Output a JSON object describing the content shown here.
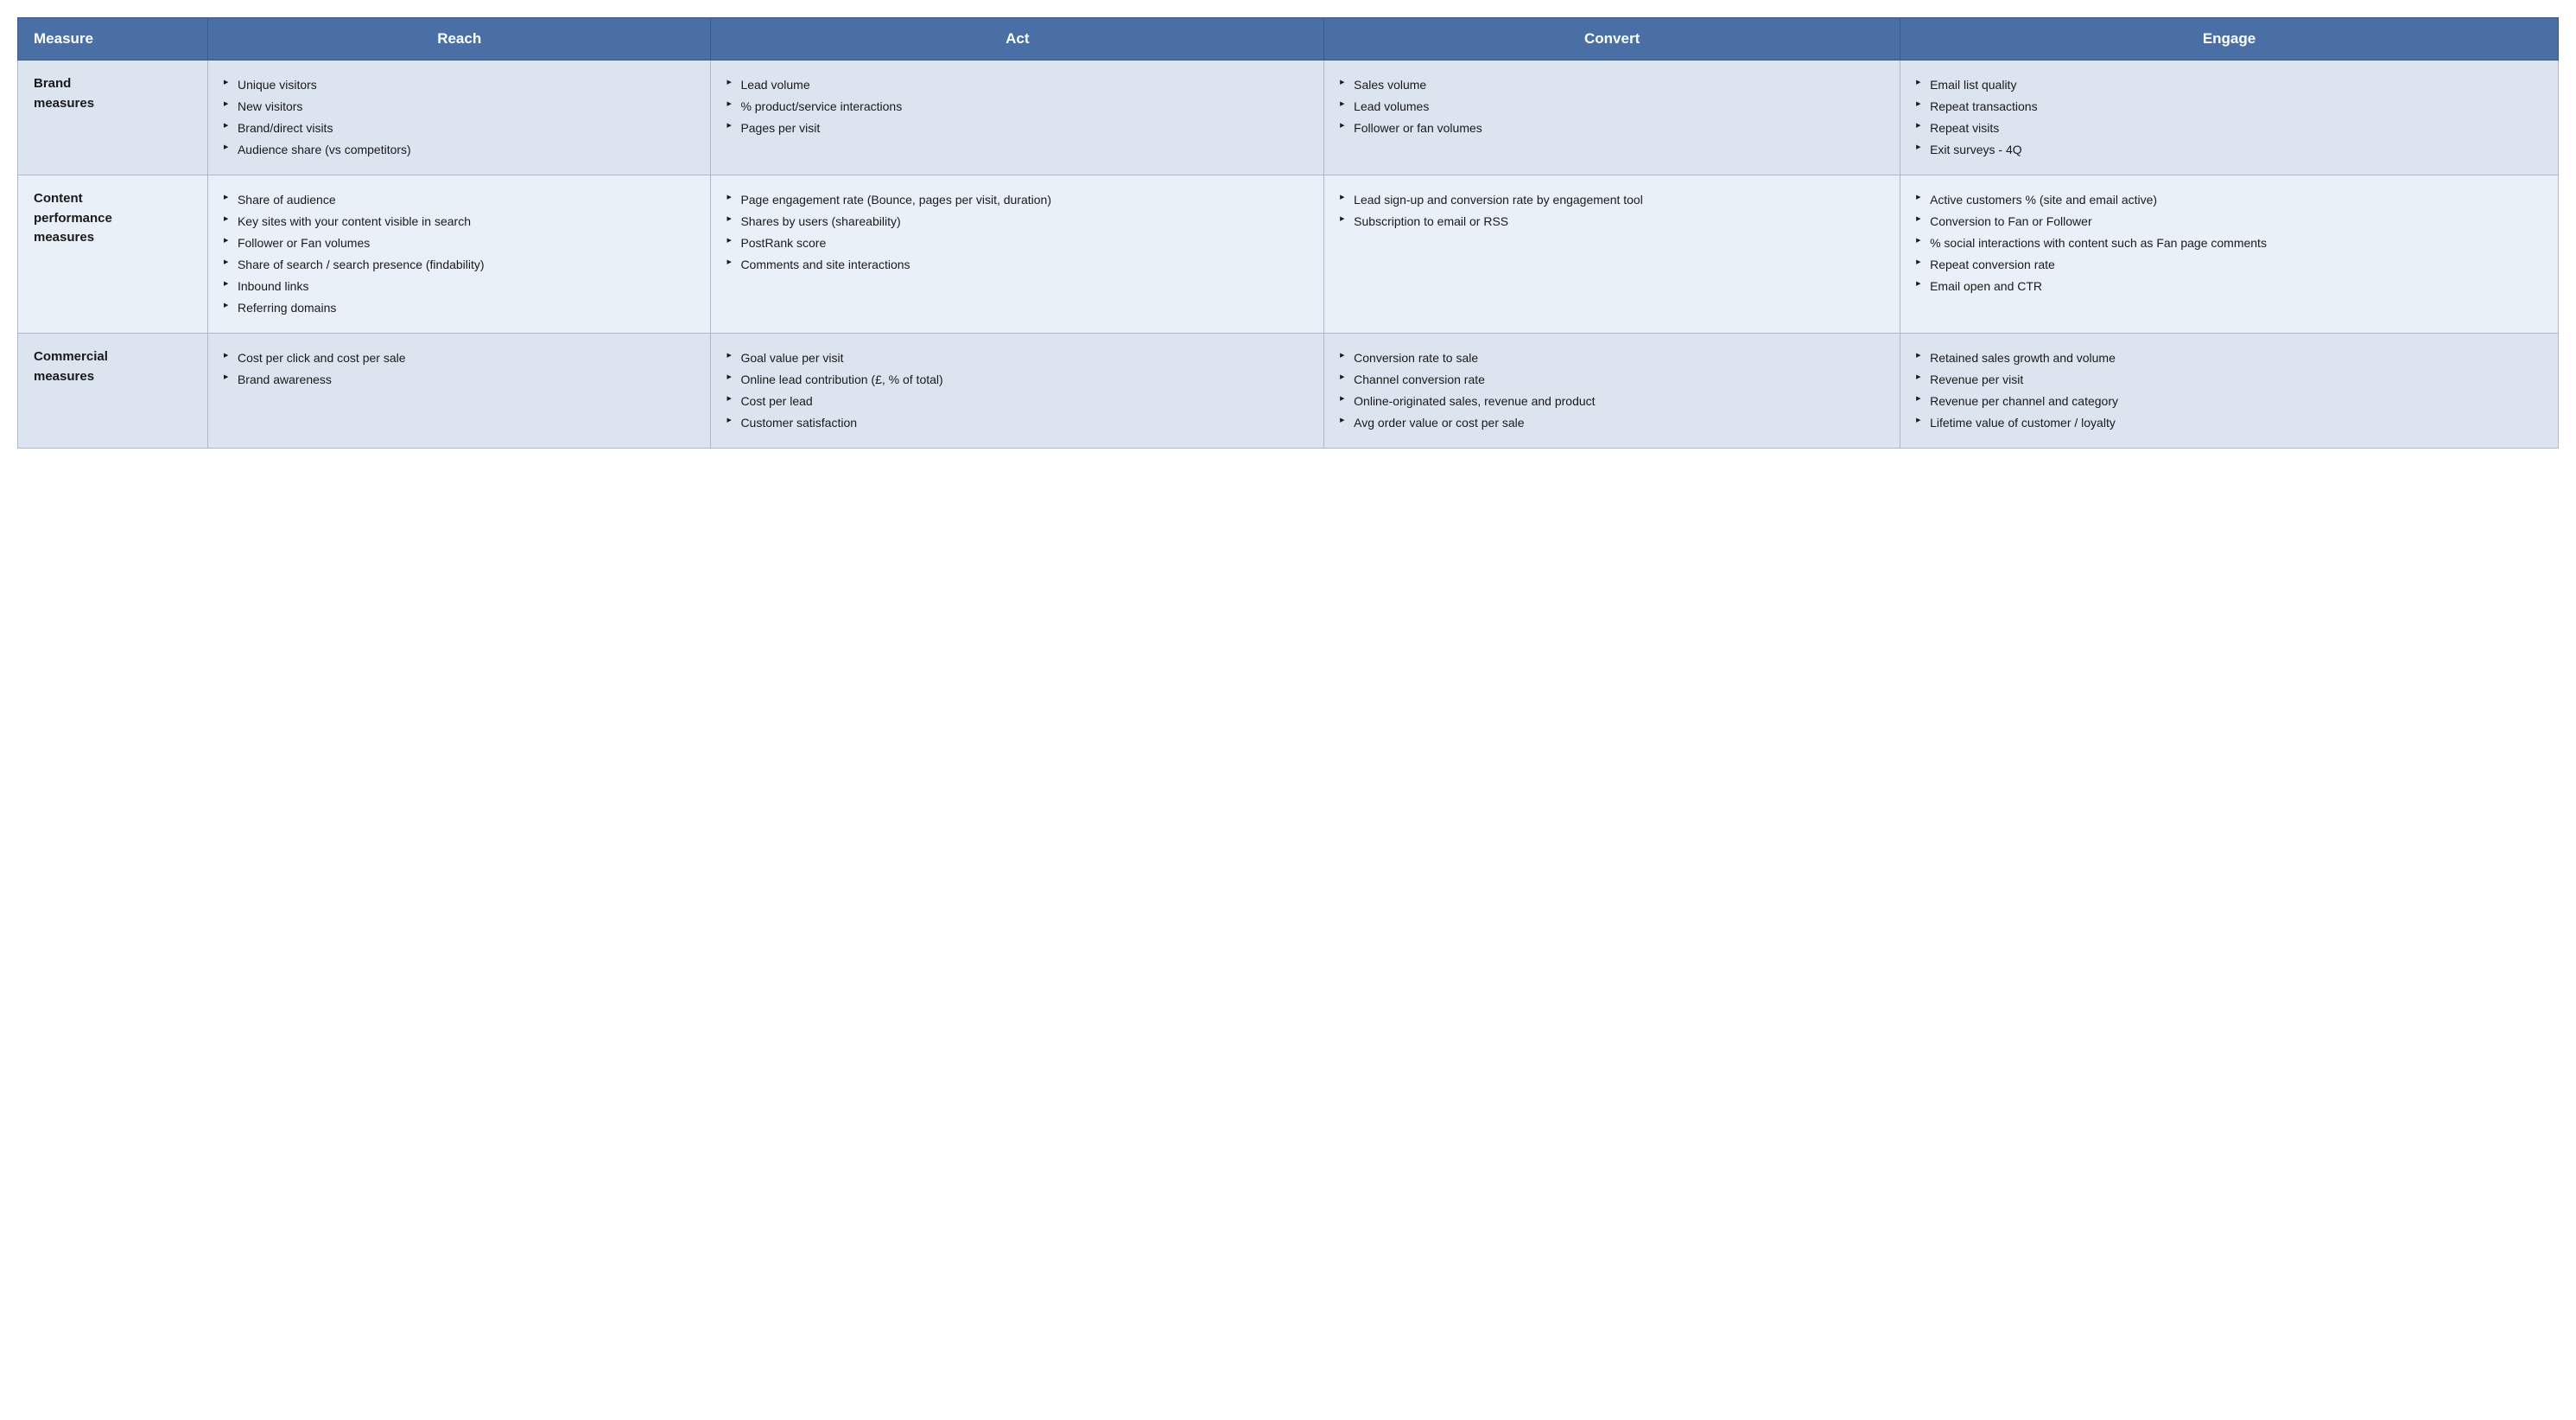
{
  "header": {
    "col1": "Measure",
    "col2": "Reach",
    "col3": "Act",
    "col4": "Convert",
    "col5": "Engage"
  },
  "rows": [
    {
      "label": "Brand\nmeasures",
      "reach": [
        "Unique visitors",
        "New visitors",
        "Brand/direct visits",
        "Audience share (vs competitors)"
      ],
      "act": [
        "Lead volume",
        "% product/service interactions",
        "Pages per visit"
      ],
      "convert": [
        "Sales volume",
        "Lead volumes",
        "Follower or fan volumes"
      ],
      "engage": [
        "Email list quality",
        "Repeat transactions",
        "Repeat visits",
        "Exit surveys - 4Q"
      ]
    },
    {
      "label": "Content\nperformance\nmeasures",
      "reach": [
        "Share of audience",
        "Key sites with your content visible in search",
        "Follower or Fan volumes",
        "Share of search / search presence (findability)",
        "Inbound links",
        "Referring domains"
      ],
      "act": [
        "Page engagement rate (Bounce, pages per visit, duration)",
        "Shares by users (shareability)",
        "PostRank score",
        "Comments and site interactions"
      ],
      "convert": [
        "Lead sign-up and conversion rate by engagement tool",
        "Subscription to email or RSS"
      ],
      "engage": [
        "Active customers % (site and email active)",
        "Conversion to Fan or Follower",
        "% social interactions with content such as Fan page comments",
        "Repeat conversion rate",
        "Email open and CTR"
      ]
    },
    {
      "label": "Commercial\nmeasures",
      "reach": [
        "Cost per click and cost per sale",
        "Brand awareness"
      ],
      "act": [
        "Goal value per visit",
        "Online lead contribution (£, % of total)",
        "Cost per lead",
        "Customer satisfaction"
      ],
      "convert": [
        "Conversion rate to sale",
        "Channel conversion rate",
        "Online-originated sales, revenue and product",
        "Avg order value or cost per sale"
      ],
      "engage": [
        "Retained sales growth and volume",
        "Revenue per visit",
        "Revenue per channel and category",
        "Lifetime value of customer / loyalty"
      ]
    }
  ]
}
